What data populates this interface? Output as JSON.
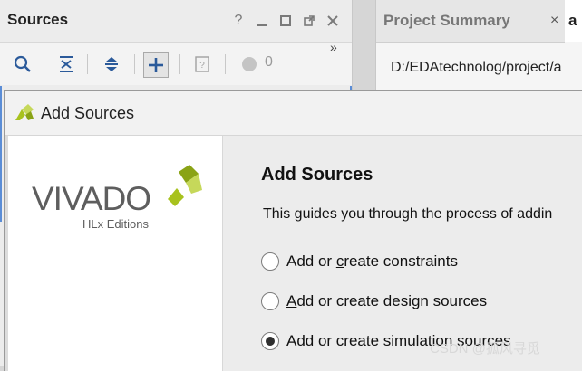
{
  "sources_panel": {
    "title": "Sources",
    "header_icons": [
      "help-icon",
      "minimize-icon",
      "maximize-icon",
      "float-icon",
      "close-icon"
    ],
    "toolbar": {
      "buttons": [
        "search-icon",
        "collapse-all-icon",
        "expand-all-icon",
        "add-icon",
        "properties-icon"
      ],
      "count": "0",
      "more": "»"
    }
  },
  "summary_panel": {
    "tab_label": "Project Summary",
    "tab_close": "×",
    "next_tab_label": "a",
    "path": "D:/EDAtechnolog/project/a"
  },
  "dialog": {
    "title": "Add Sources",
    "logo_text": "VIVADO",
    "logo_subtitle": "HLx Editions",
    "heading": "Add Sources",
    "description": "This guides you through the process of addin",
    "options": [
      {
        "pre": "Add or ",
        "u": "c",
        "post": "reate constraints",
        "selected": false
      },
      {
        "pre": "",
        "u": "A",
        "post": "dd or create design sources",
        "selected": false
      },
      {
        "pre": "Add or create ",
        "u": "s",
        "post": "imulation sources",
        "selected": true
      }
    ]
  },
  "watermark": "CSDN @孤风寻觅",
  "colors": {
    "accent": "#5b8dd6",
    "logo_green": "#a8c21e"
  }
}
